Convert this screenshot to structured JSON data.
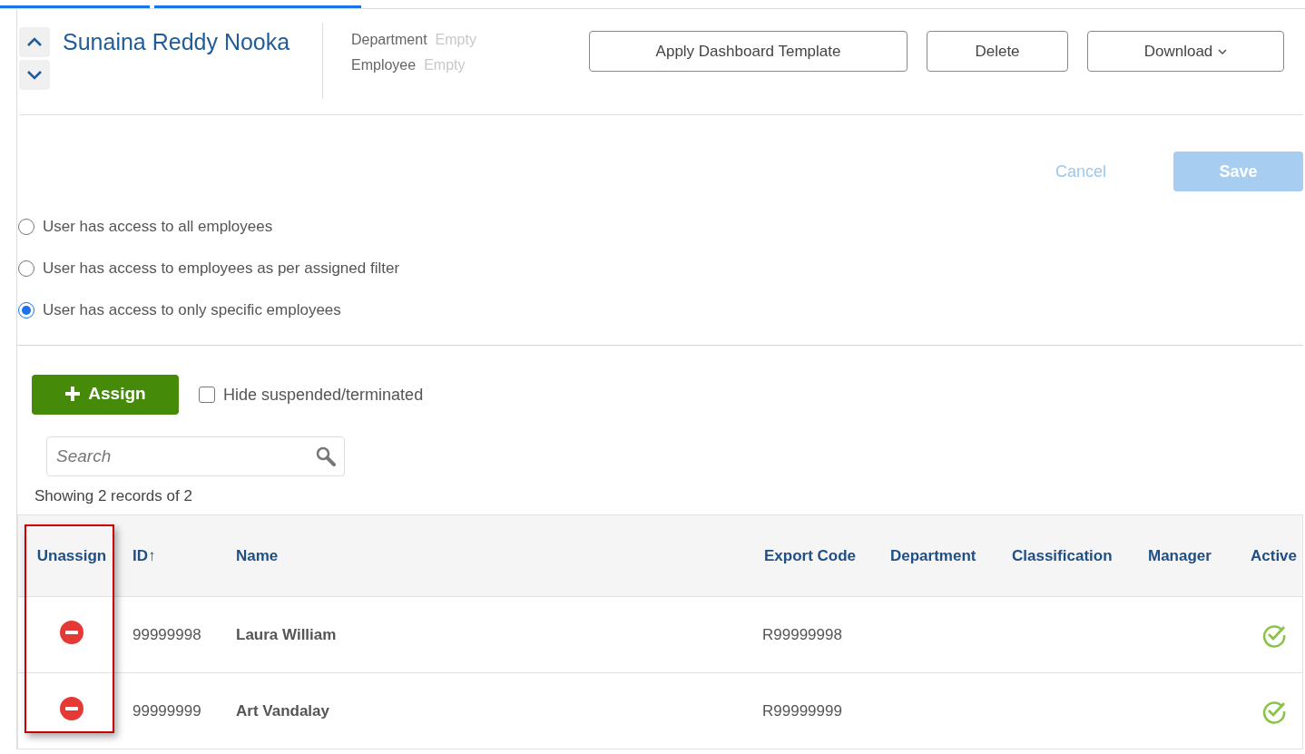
{
  "header": {
    "name": "Sunaina Reddy Nooka",
    "fields": [
      {
        "label": "Department",
        "value": "Empty"
      },
      {
        "label": "Employee",
        "value": "Empty"
      }
    ],
    "buttons": [
      {
        "label": "Apply Dashboard Template",
        "kind": "plain"
      },
      {
        "label": "Delete",
        "kind": "plain"
      },
      {
        "label": "Download",
        "kind": "dropdown"
      }
    ]
  },
  "actions": {
    "cancel": "Cancel",
    "save": "Save",
    "save_disabled": true
  },
  "access_options": [
    {
      "label": "User has access to all employees",
      "selected": false
    },
    {
      "label": "User has access to employees as per assigned filter",
      "selected": false
    },
    {
      "label": "User has access to only specific employees",
      "selected": true
    }
  ],
  "assign_button": "Assign",
  "hide_suspended": {
    "label": "Hide suspended/terminated",
    "checked": false
  },
  "search": {
    "placeholder": "Search"
  },
  "record_count": "Showing 2 records of 2",
  "table": {
    "columns": [
      {
        "label": "Unassign",
        "highlighted": true
      },
      {
        "label": "ID↑",
        "highlighted": false
      },
      {
        "label": "Name",
        "highlighted": false
      },
      {
        "label": "Export Code",
        "highlighted": false
      },
      {
        "label": "Department",
        "highlighted": false
      },
      {
        "label": "Classification",
        "highlighted": false
      },
      {
        "label": "Manager",
        "highlighted": false
      },
      {
        "label": "Active",
        "highlighted": false
      }
    ],
    "rows": [
      {
        "id": "99999998",
        "name": "Laura William",
        "export_code": "R99999998",
        "active": true
      },
      {
        "id": "99999999",
        "name": "Art Vandalay",
        "export_code": "R99999999",
        "active": true
      }
    ]
  }
}
